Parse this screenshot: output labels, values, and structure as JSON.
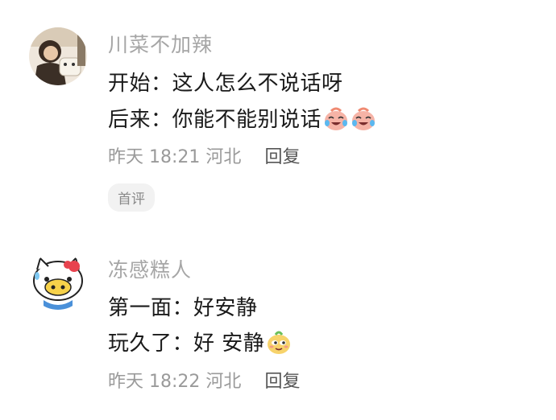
{
  "comments": [
    {
      "username": "川菜不加辣",
      "lines": [
        "开始：这人怎么不说话呀",
        "后来：你能不能别说话"
      ],
      "line2_emojis": [
        "crying-laugh-emoji",
        "crying-laugh-emoji"
      ],
      "date": "昨天",
      "time": "18:21",
      "location": "河北",
      "reply_label": "回复",
      "badge": "首评"
    },
    {
      "username": "冻感糕人",
      "lines": [
        "第一面：好安静",
        "玩久了：好 安静"
      ],
      "line2_emojis": [
        "smirk-emoji"
      ],
      "date": "昨天",
      "time": "18:22",
      "location": "河北",
      "reply_label": "回复"
    }
  ]
}
